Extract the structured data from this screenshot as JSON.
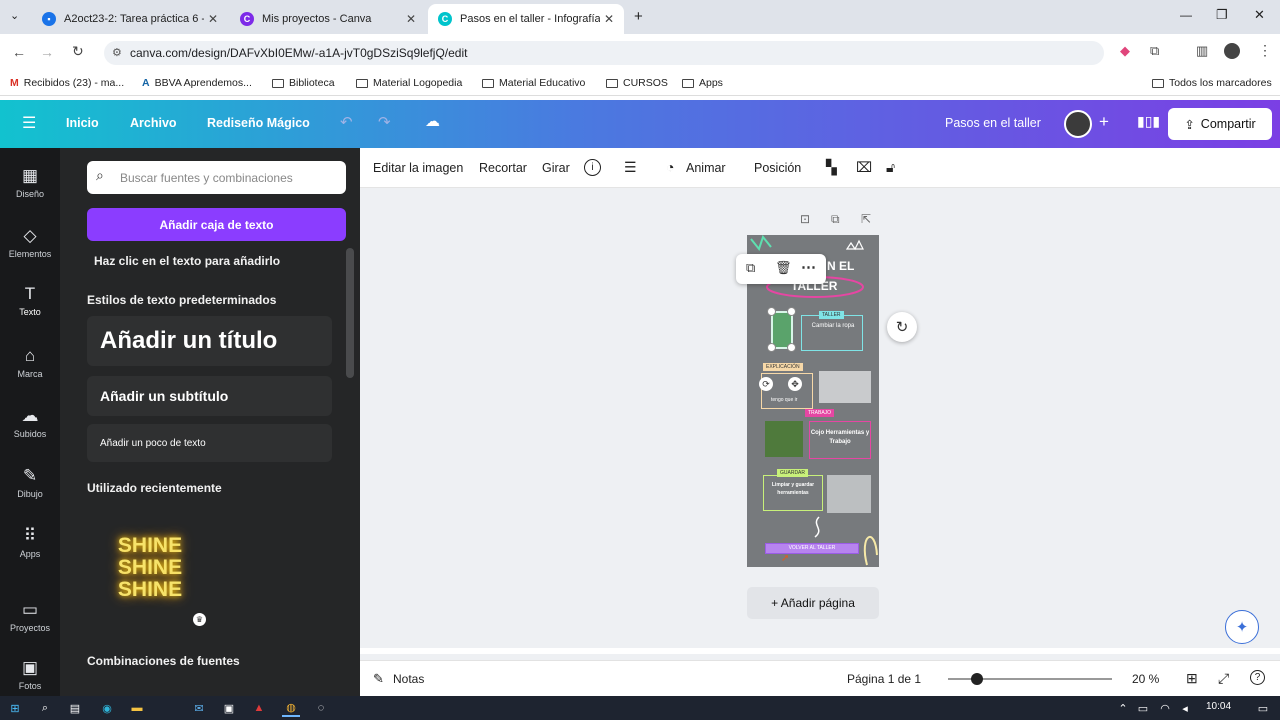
{
  "browser": {
    "tabs": [
      {
        "title": "A2oct23-2: Tarea práctica 6 - N",
        "favicon": "classroom-icon",
        "active": false
      },
      {
        "title": "Mis proyectos - Canva",
        "favicon": "canva-icon",
        "active": false
      },
      {
        "title": "Pasos en el taller - Infografía",
        "favicon": "canva-icon",
        "active": true
      }
    ],
    "url": "canva.com/design/DAFvXbI0EMw/-a1A-jvT0gDSziSq9lefjQ/edit",
    "bookmarks": [
      "Recibidos (23) - ma...",
      "BBVA Aprendemos...",
      "Biblioteca",
      "Material Logopedia",
      "Material Educativo",
      "CURSOS",
      "Apps"
    ],
    "all_bookmarks": "Todos los marcadores"
  },
  "header": {
    "home": "Inicio",
    "file": "Archivo",
    "magic": "Rediseño Mágico",
    "design_title": "Pasos en el taller",
    "share": "Compartir"
  },
  "sidebar": [
    {
      "label": "Diseño",
      "icon": "layout-icon"
    },
    {
      "label": "Elementos",
      "icon": "shapes-icon"
    },
    {
      "label": "Texto",
      "icon": "text-icon"
    },
    {
      "label": "Marca",
      "icon": "brand-icon"
    },
    {
      "label": "Subidos",
      "icon": "upload-icon"
    },
    {
      "label": "Dibujo",
      "icon": "draw-icon"
    },
    {
      "label": "Apps",
      "icon": "apps-icon"
    },
    {
      "label": "Proyectos",
      "icon": "folder-icon"
    },
    {
      "label": "Fotos",
      "icon": "photo-icon"
    }
  ],
  "panel": {
    "search_placeholder": "Buscar fuentes y combinaciones",
    "add_textbox": "Añadir caja de texto",
    "click_hint": "Haz clic en el texto para añadirlo",
    "default_styles": "Estilos de texto predeterminados",
    "add_title": "Añadir un título",
    "add_subtitle": "Añadir un subtítulo",
    "add_body": "Añadir un poco de texto",
    "recent": "Utilizado recientemente",
    "shine": "SHINE",
    "font_combos": "Combinaciones de fuentes"
  },
  "toolbar": {
    "edit_image": "Editar la imagen",
    "crop": "Recortar",
    "flip": "Girar",
    "animate": "Animar",
    "position": "Posición"
  },
  "design": {
    "title_part1": "N EL",
    "title_part2": "TALLER",
    "taller_tag": "TALLER",
    "taller_text": "Cambiar la ropa",
    "expl_tag": "EXPLICACIÓN",
    "expl_text": "tengo que ir",
    "trabajo_tag": "TRABAJO",
    "trabajo_text": "Cojo Herramientas y Trabajo",
    "guardar_tag": "GUARDAR",
    "guardar_text": "Limpiar y guardar herramientas",
    "volver": "VOLVER AL TALLER"
  },
  "canvas": {
    "add_page": "+ Añadir página"
  },
  "bottom": {
    "notes": "Notas",
    "page": "Página 1 de 1",
    "zoom": "20 %",
    "zoom_level": 0.2
  },
  "taskbar": {
    "time": "10:04"
  }
}
